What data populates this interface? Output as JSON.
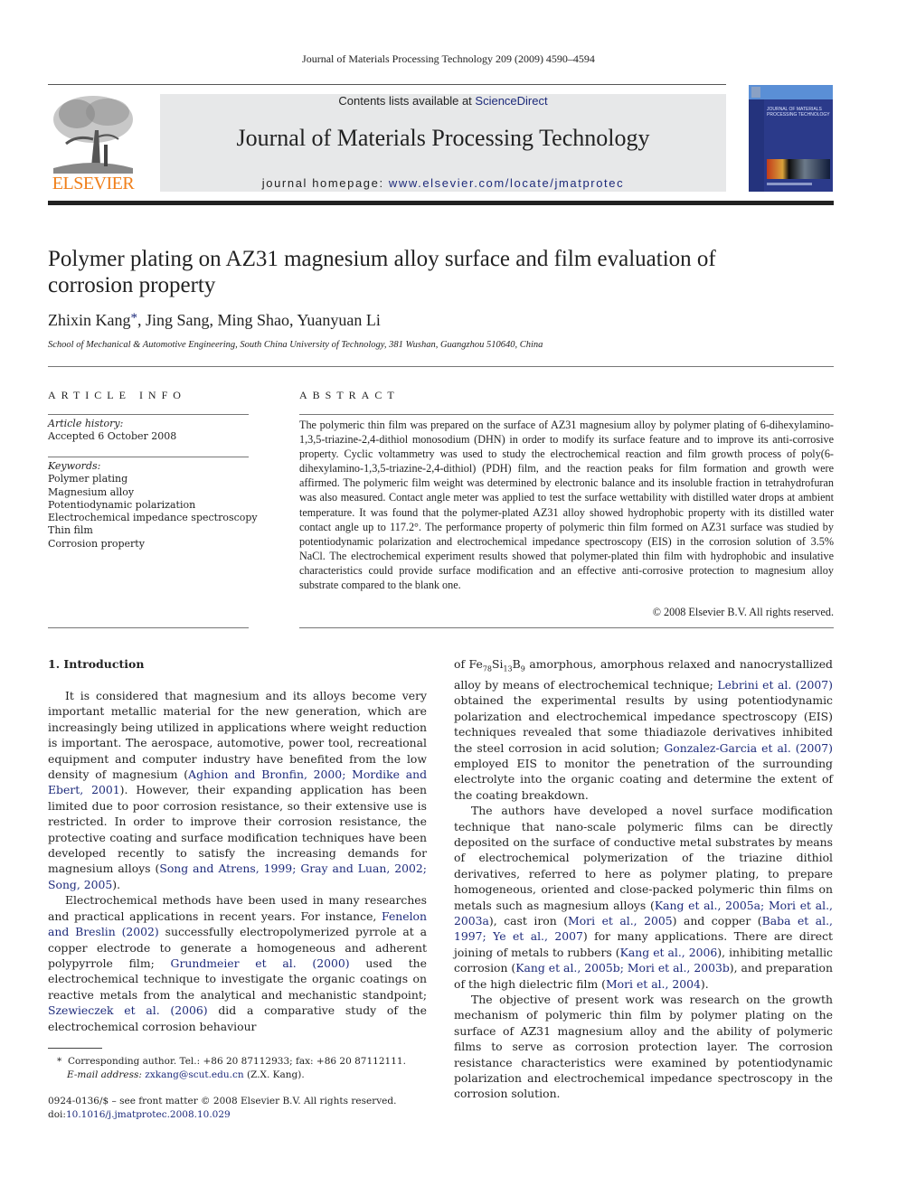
{
  "running_head": "Journal of Materials Processing Technology 209 (2009) 4590–4594",
  "header": {
    "publisher_logo_text": "ELSEVIER",
    "contents_prefix": "Contents lists available at ",
    "contents_link": "ScienceDirect",
    "journal_title": "Journal of Materials Processing Technology",
    "homepage_prefix": "journal homepage: ",
    "homepage_link": "www.elsevier.com/locate/jmatprotec",
    "cover_title_line1": "JOURNAL OF MATERIALS",
    "cover_title_line2": "PROCESSING TECHNOLOGY",
    "colors": {
      "logo_orange": "#f07f1a",
      "link_blue": "#1d2a7a",
      "banner_gray": "#e7e8e9",
      "cover_blue": "#2b3a8a"
    }
  },
  "article": {
    "title": "Polymer plating on AZ31 magnesium alloy surface and film evaluation of corrosion property",
    "authors": [
      {
        "name": "Zhixin Kang",
        "corresponding_mark": "*"
      },
      {
        "name": "Jing Sang"
      },
      {
        "name": "Ming Shao"
      },
      {
        "name": "Yuanyuan Li"
      }
    ],
    "affiliation": "School of Mechanical & Automotive Engineering, South China University of Technology, 381 Wushan, Guangzhou 510640, China"
  },
  "article_info": {
    "heading": "ARTICLE INFO",
    "history_label": "Article history:",
    "history_value": "Accepted 6 October 2008",
    "keywords_label": "Keywords:",
    "keywords": [
      "Polymer plating",
      "Magnesium alloy",
      "Potentiodynamic polarization",
      "Electrochemical impedance spectroscopy",
      "Thin film",
      "Corrosion property"
    ]
  },
  "abstract": {
    "heading": "ABSTRACT",
    "text": "The polymeric thin film was prepared on the surface of AZ31 magnesium alloy by polymer plating of 6-dihexylamino-1,3,5-triazine-2,4-dithiol monosodium (DHN) in order to modify its surface feature and to improve its anti-corrosive property. Cyclic voltammetry was used to study the electrochemical reaction and film growth process of poly(6-dihexylamino-1,3,5-triazine-2,4-dithiol) (PDH) film, and the reaction peaks for film formation and growth were affirmed. The polymeric film weight was determined by electronic balance and its insoluble fraction in tetrahydrofuran was also measured. Contact angle meter was applied to test the surface wettability with distilled water drops at ambient temperature. It was found that the polymer-plated AZ31 alloy showed hydrophobic property with its distilled water contact angle up to 117.2°. The performance property of polymeric thin film formed on AZ31 surface was studied by potentiodynamic polarization and electrochemical impedance spectroscopy (EIS) in the corrosion solution of 3.5% NaCl. The electrochemical experiment results showed that polymer-plated thin film with hydrophobic and insulative characteristics could provide surface modification and an effective anti-corrosive protection to magnesium alloy substrate compared to the blank one.",
    "copyright": "© 2008 Elsevier B.V. All rights reserved."
  },
  "introduction": {
    "heading": "1.  Introduction",
    "p1": {
      "t1": "It is considered that magnesium and its alloys become very important metallic material for the new generation, which are increasingly being utilized in applications where weight reduction is important. The aerospace, automotive, power tool, recreational equipment and computer industry have benefited from the low density of magnesium (",
      "c1": "Aghion and Bronfin, 2000; Mordike and Ebert, 2001",
      "t2": "). However, their expanding application has been limited due to poor corrosion resistance, so their extensive use is restricted. In order to improve their corrosion resistance, the protective coating and surface modification techniques have been developed recently to satisfy the increasing demands for magnesium alloys (",
      "c2": "Song and Atrens, 1999; Gray and Luan, 2002; Song, 2005",
      "t3": ")."
    },
    "p2": {
      "t1": "Electrochemical methods have been used in many researches and practical applications in recent years. For instance, ",
      "c1": "Fenelon and Breslin (2002)",
      "t2": " successfully electropolymerized pyrrole at a copper electrode to generate a homogeneous and adherent polypyrrole film; ",
      "c2": "Grundmeier et al. (2000)",
      "t3": " used the electrochemical technique to investigate the organic coatings on reactive metals from the analytical and mechanistic standpoint; ",
      "c3": "Szewieczek et al. (2006)",
      "t4": " did a comparative study of the electrochemical corrosion behaviour"
    },
    "p2_cont": {
      "t0": "of Fe",
      "s1": "78",
      "t0b": "Si",
      "s2": "13",
      "t0c": "B",
      "s3": "9",
      "t1": " amorphous, amorphous relaxed and nanocrystallized alloy by means of electrochemical technique; ",
      "c1": "Lebrini et al. (2007)",
      "t2": " obtained the experimental results by using potentiodynamic polarization and electrochemical impedance spectroscopy (EIS) techniques revealed that some thiadiazole derivatives inhibited the steel corrosion in acid solution; ",
      "c2": "Gonzalez-Garcia et al. (2007)",
      "t3": " employed EIS to monitor the penetration of the surrounding electrolyte into the organic coating and determine the extent of the coating breakdown."
    },
    "p3": {
      "t1": "The authors have developed a novel surface modification technique that nano-scale polymeric films can be directly deposited on the surface of conductive metal substrates by means of electrochemical polymerization of the triazine dithiol derivatives, referred to here as polymer plating, to prepare homogeneous, oriented and close-packed polymeric thin films on metals such as magnesium alloys (",
      "c1": "Kang et al., 2005a; Mori et al., 2003a",
      "t2": "), cast iron (",
      "c2": "Mori et al., 2005",
      "t3": ") and copper (",
      "c3": "Baba et al., 1997; Ye et al., 2007",
      "t4": ") for many applications. There are direct joining of metals to rubbers (",
      "c4": "Kang et al., 2006",
      "t5": "), inhibiting metallic corrosion (",
      "c5": "Kang et al., 2005b; Mori et al., 2003b",
      "t6": "), and preparation of the high dielectric film (",
      "c6": "Mori et al., 2004",
      "t7": ")."
    },
    "p4": "The objective of present work was research on the growth mechanism of polymeric thin film by polymer plating on the surface of AZ31 magnesium alloy and the ability of polymeric films to serve as corrosion protection layer. The corrosion resistance characteristics were examined by potentiodynamic polarization and electrochemical impedance spectroscopy in the corrosion solution."
  },
  "footnote": {
    "mark": "*",
    "corresponding": "Corresponding author. Tel.: +86 20 87112933; fax: +86 20 87112111.",
    "email_label": "E-mail address:",
    "email": "zxkang@scut.edu.cn",
    "email_suffix": " (Z.X. Kang)."
  },
  "front_matter": {
    "issn_line": "0924-0136/$ – see front matter © 2008 Elsevier B.V. All rights reserved.",
    "doi_prefix": "doi:",
    "doi": "10.1016/j.jmatprotec.2008.10.029"
  }
}
